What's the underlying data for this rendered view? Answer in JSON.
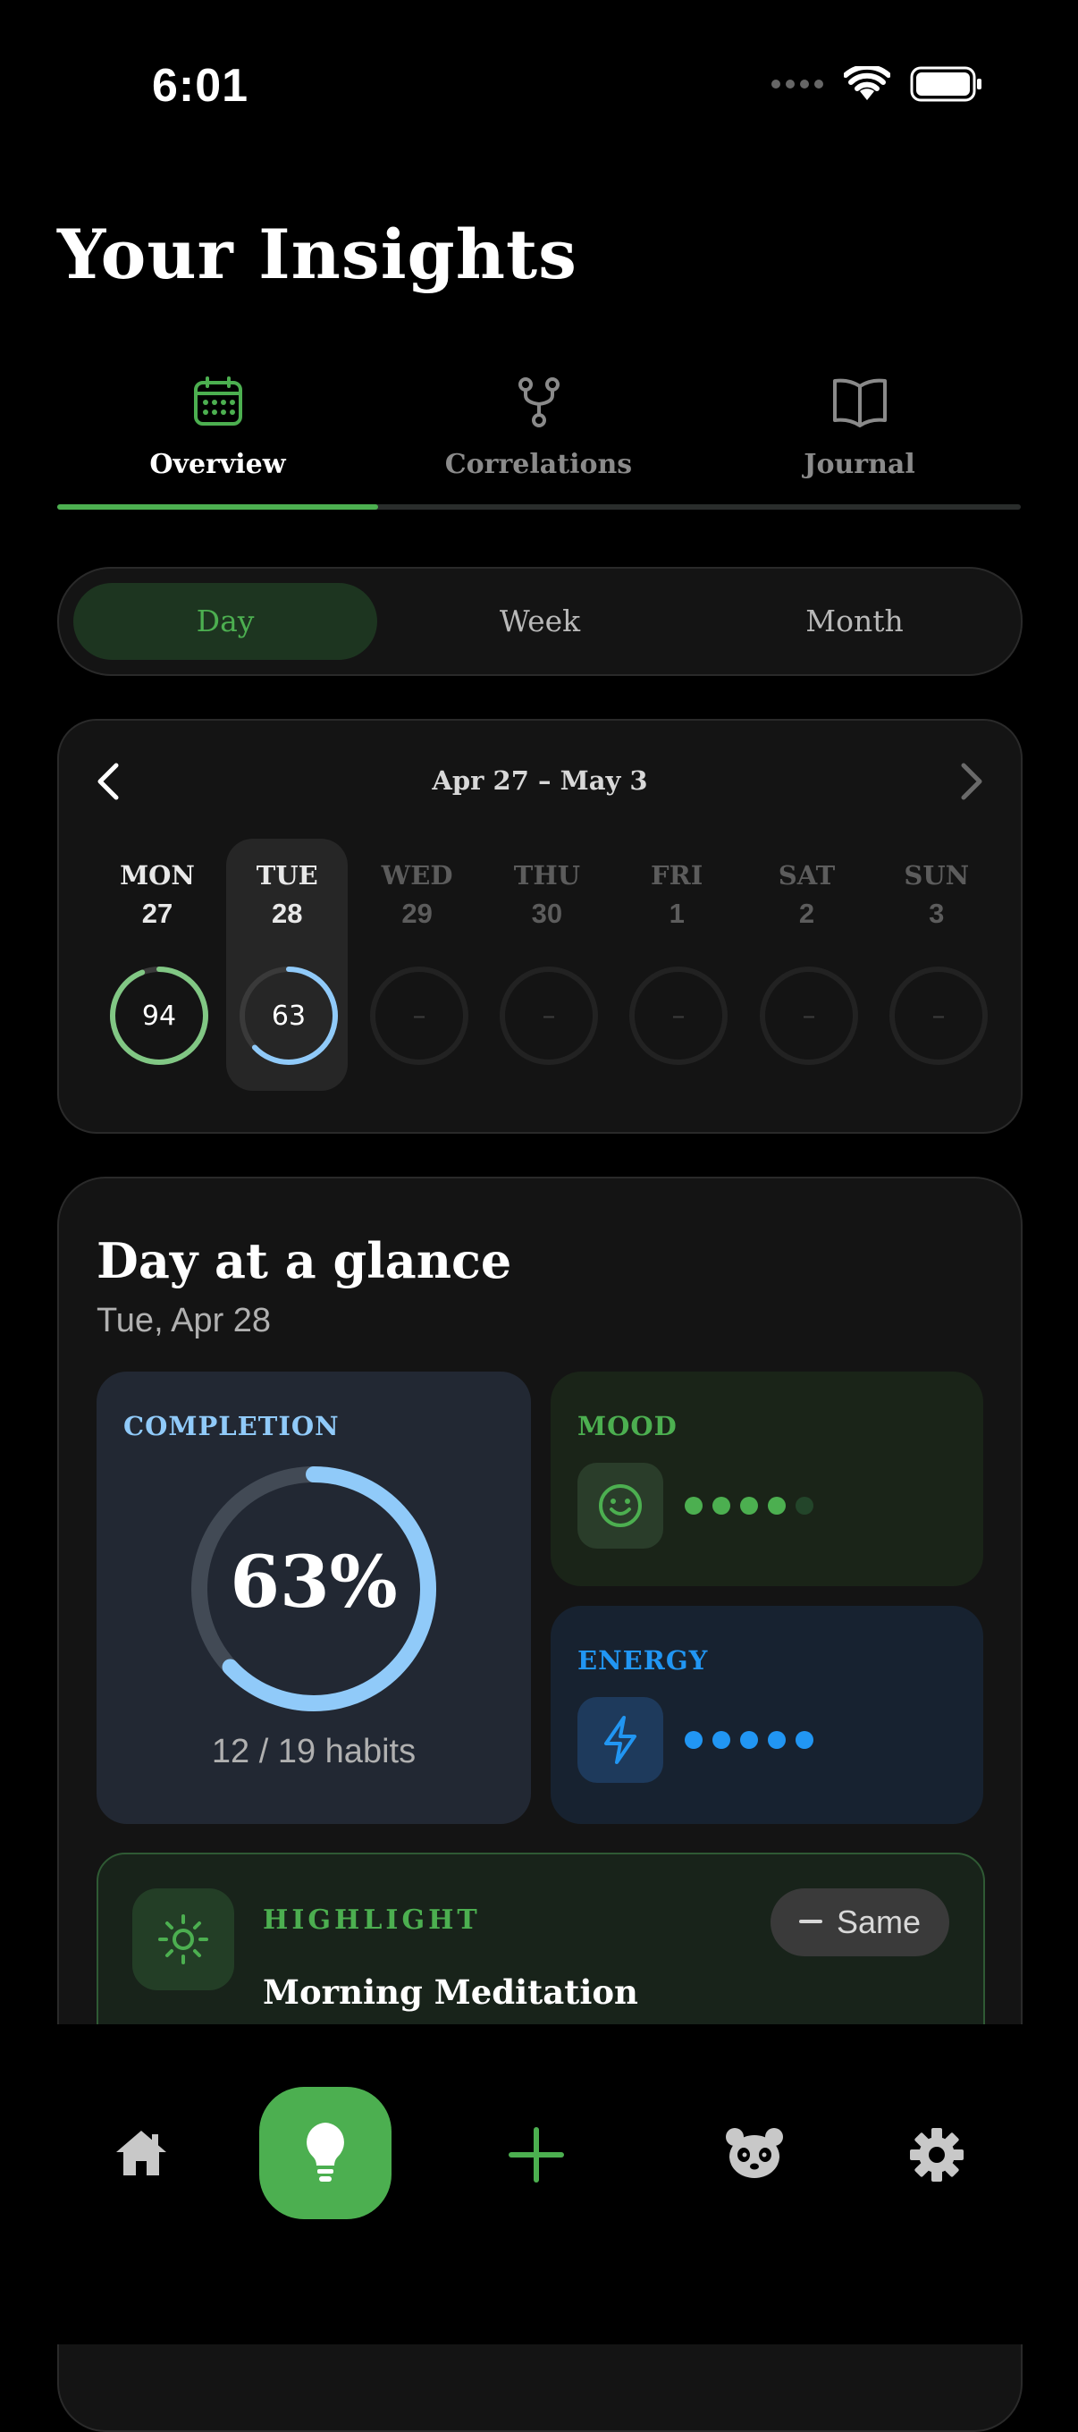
{
  "status_bar": {
    "time": "6:01"
  },
  "page_title": "Your Insights",
  "tabs": [
    {
      "label": "Overview",
      "icon": "calendar-icon",
      "active": true
    },
    {
      "label": "Correlations",
      "icon": "fork-icon",
      "active": false
    },
    {
      "label": "Journal",
      "icon": "book-icon",
      "active": false
    }
  ],
  "period": {
    "options": [
      "Day",
      "Week",
      "Month"
    ],
    "selected": "Day"
  },
  "week": {
    "range": "Apr 27 – May 3",
    "days": [
      {
        "name": "MON",
        "date": "27",
        "score": "94",
        "color": "#81c784",
        "fraction": 0.94
      },
      {
        "name": "TUE",
        "date": "28",
        "score": "63",
        "color": "#90caf9",
        "fraction": 0.63,
        "selected": true
      },
      {
        "name": "WED",
        "date": "29",
        "score": "–"
      },
      {
        "name": "THU",
        "date": "30",
        "score": "–"
      },
      {
        "name": "FRI",
        "date": "1",
        "score": "–"
      },
      {
        "name": "SAT",
        "date": "2",
        "score": "–"
      },
      {
        "name": "SUN",
        "date": "3",
        "score": "–"
      }
    ]
  },
  "glance": {
    "title": "Day at a glance",
    "date": "Tue, Apr 28",
    "completion": {
      "label": "COMPLETION",
      "percent": "63%",
      "fraction": 0.63,
      "habits": "12 / 19 habits"
    },
    "mood": {
      "label": "MOOD",
      "level": 4,
      "max": 5,
      "icon": "smiley-face-icon"
    },
    "energy": {
      "label": "ENERGY",
      "level": 5,
      "max": 5,
      "icon": "lightning-bolt-icon"
    },
    "highlight": {
      "label": "HIGHLIGHT",
      "title": "Morning Meditation",
      "badge": "Same",
      "icon": "sun-icon"
    }
  },
  "bottom_nav": [
    {
      "name": "home-icon"
    },
    {
      "name": "lightbulb-icon",
      "active": true
    },
    {
      "name": "plus-icon"
    },
    {
      "name": "panda-icon"
    },
    {
      "name": "gear-icon"
    }
  ],
  "colors": {
    "accent": "#4caf50",
    "blue": "#90caf9",
    "energy_blue": "#2196f3",
    "bg": "#000000",
    "card": "#141414"
  }
}
